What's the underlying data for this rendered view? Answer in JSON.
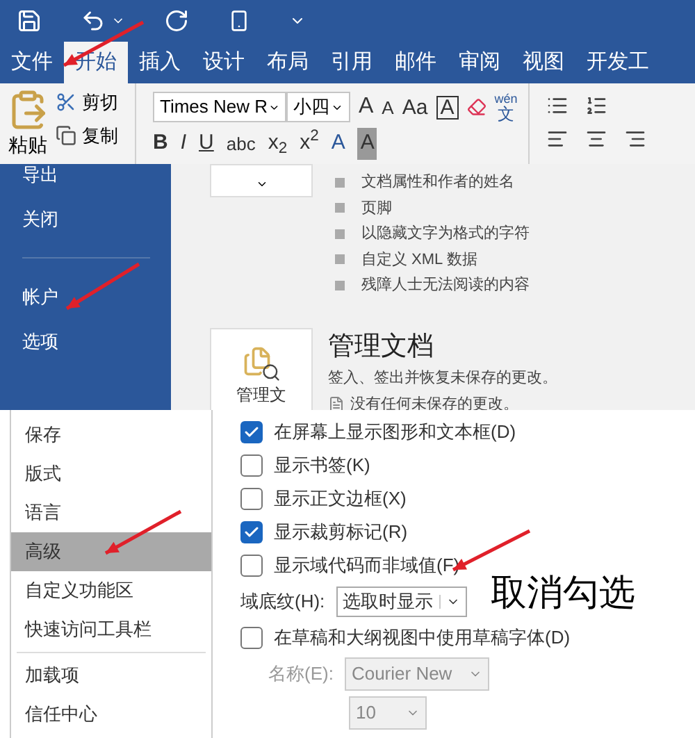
{
  "ribbon_tabs": [
    {
      "label": "文件",
      "selected": false
    },
    {
      "label": "开始",
      "selected": true
    },
    {
      "label": "插入",
      "selected": false
    },
    {
      "label": "设计",
      "selected": false
    },
    {
      "label": "布局",
      "selected": false
    },
    {
      "label": "引用",
      "selected": false
    },
    {
      "label": "邮件",
      "selected": false
    },
    {
      "label": "审阅",
      "selected": false
    },
    {
      "label": "视图",
      "selected": false
    },
    {
      "label": "开发工",
      "selected": false
    }
  ],
  "clipboard": {
    "paste": "粘贴",
    "cut": "剪切",
    "copy": "复制"
  },
  "font": {
    "name": "Times New R",
    "size": "小四",
    "phonetic_top": "wén",
    "phonetic_bottom": "文",
    "row1": [
      {
        "label": "A",
        "kind": "grow"
      },
      {
        "label": "A",
        "kind": "shrink"
      },
      {
        "label": "Aa",
        "kind": "case"
      },
      {
        "label": "A",
        "kind": "boxed"
      }
    ],
    "row2": [
      {
        "label": "B",
        "kind": "bold"
      },
      {
        "label": "I",
        "kind": "italic"
      },
      {
        "label": "U",
        "kind": "underline"
      },
      {
        "label": "abc",
        "kind": "strike"
      },
      {
        "label": "x$_{2}$",
        "kind": "script"
      },
      {
        "label": "x$^{2}$",
        "kind": "script"
      },
      {
        "label": "A",
        "kind": "color"
      },
      {
        "label": "A",
        "kind": "shade"
      }
    ]
  },
  "backstage": {
    "menu": [
      {
        "label": "导出",
        "divider_before": false
      },
      {
        "label": "关闭",
        "divider_before": false
      },
      {
        "label": "帐户",
        "divider_before": true
      },
      {
        "label": "选项",
        "divider_before": false
      }
    ],
    "inspect_items": [
      "文档属性和作者的姓名",
      "页脚",
      "以隐藏文字为格式的字符",
      "自定义 XML 数据",
      "残障人士无法阅读的内容"
    ],
    "manage": {
      "button": "管理文",
      "title": "管理文档",
      "description": "签入、签出并恢复未保存的更改。",
      "note": "没有任何未保存的更改。"
    }
  },
  "options": {
    "nav": [
      {
        "label": "保存",
        "selected": false
      },
      {
        "label": "版式",
        "selected": false
      },
      {
        "label": "语言",
        "selected": false
      },
      {
        "label": "高级",
        "selected": true
      },
      {
        "label": "自定义功能区",
        "selected": false
      },
      {
        "label": "快速访问工具栏",
        "selected": false
      },
      {
        "label": "加载项",
        "selected": false,
        "divider_before": true
      },
      {
        "label": "信任中心",
        "selected": false
      }
    ],
    "checks": [
      {
        "label": "在屏幕上显示图形和文本框(D)",
        "checked": true
      },
      {
        "label": "显示书签(K)",
        "checked": false
      },
      {
        "label": "显示正文边框(X)",
        "checked": false
      },
      {
        "label": "显示裁剪标记(R)",
        "checked": true
      },
      {
        "label": "显示域代码而非域值(F)",
        "checked": false
      }
    ],
    "shading": {
      "label": "域底纹(H):",
      "value": "选取时显示"
    },
    "draft_font": {
      "label": "在草稿和大纲视图中使用草稿字体(D)",
      "checked": false
    },
    "font_name": {
      "label": "名称(E):",
      "value": "Courier New",
      "disabled": true
    },
    "font_size": {
      "value": "10",
      "disabled": true
    }
  },
  "annotation": "取消勾选"
}
